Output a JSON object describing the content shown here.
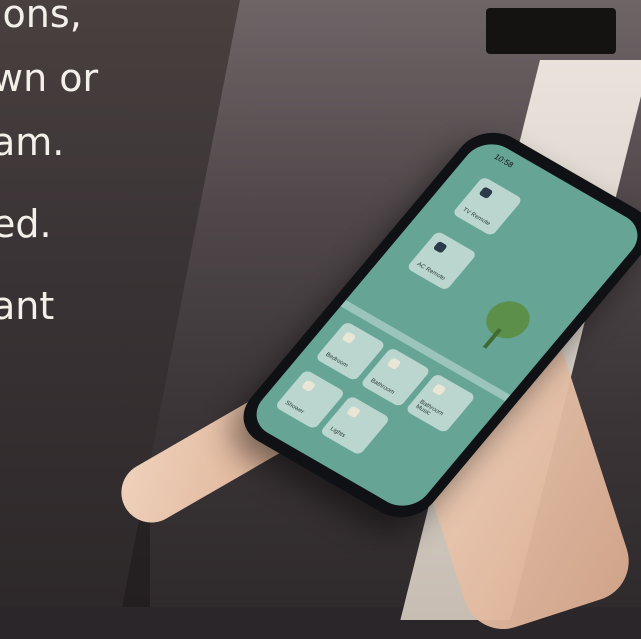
{
  "caption": {
    "lines": [
      "ions,",
      "wn or",
      "am.",
      "ed.",
      "ant"
    ]
  },
  "phone": {
    "status_time": "10:58",
    "tiles": [
      {
        "label": "TV Remote"
      },
      {
        "label": "AC Remote"
      },
      {
        "label": "Bedroom"
      },
      {
        "label": "Bathroom"
      },
      {
        "label": "Bathroom Music"
      },
      {
        "label": "Shower"
      },
      {
        "label": "Lights"
      }
    ]
  }
}
